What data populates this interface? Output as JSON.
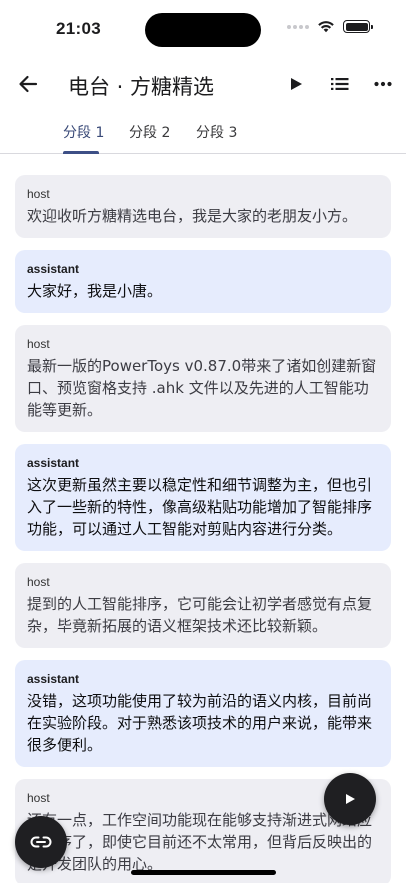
{
  "status_bar": {
    "time": "21:03"
  },
  "app_bar": {
    "title": "电台 · 方糖精选",
    "icons": [
      "back-arrow-icon",
      "play-icon",
      "list-icon",
      "more-icon"
    ]
  },
  "tabs": [
    {
      "label": "分段 1",
      "active": true
    },
    {
      "label": "分段 2",
      "active": false
    },
    {
      "label": "分段 3",
      "active": false
    }
  ],
  "messages": [
    {
      "role": "host",
      "text": "欢迎收听方糖精选电台，我是大家的老朋友小方。"
    },
    {
      "role": "assistant",
      "text": "大家好，我是小唐。"
    },
    {
      "role": "host",
      "text": "最新一版的PowerToys v0.87.0带来了诸如创建新窗口、预览窗格支持 .ahk 文件以及先进的人工智能功能等更新。"
    },
    {
      "role": "assistant",
      "text": "这次更新虽然主要以稳定性和细节调整为主，但也引入了一些新的特性，像高级粘贴功能增加了智能排序功能，可以通过人工智能对剪贴内容进行分类。"
    },
    {
      "role": "host",
      "text": "提到的人工智能排序，它可能会让初学者感觉有点复杂，毕竟新拓展的语义框架技术还比较新颖。"
    },
    {
      "role": "assistant",
      "text": "没错，这项功能使用了较为前沿的语义内核，目前尚在实验阶段。对于熟悉该项技术的用户来说，能带来很多便利。"
    },
    {
      "role": "host",
      "text": "还有一点，工作空间功能现在能够支持渐进式网络应用程序了，即使它目前还不太常用，但背后反映出的是开发团队的用心。"
    }
  ],
  "fabs": {
    "play_icon": "play-icon",
    "link_icon": "link-icon"
  },
  "colors": {
    "host_bubble": "#eeeef3",
    "assistant_bubble": "#e6ecfd",
    "tab_accent": "#3d4f86",
    "fab": "#1f1f22"
  }
}
